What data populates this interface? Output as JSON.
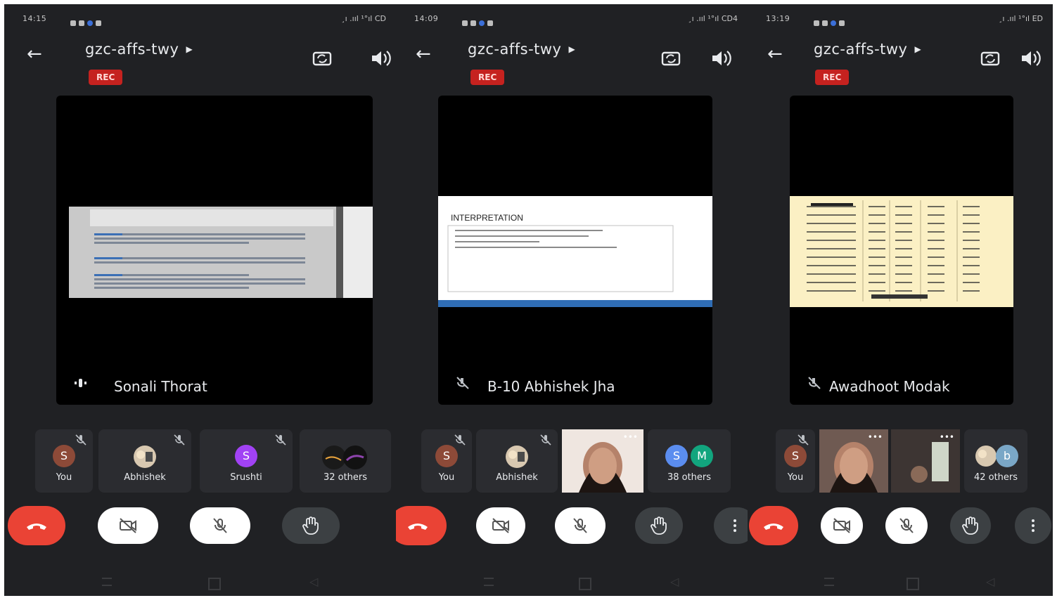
{
  "accent": {
    "red": "#ea4335",
    "rec": "#c5221f",
    "purple": "#8e44ad",
    "teal": "#1e8e3e",
    "blue": "#3c78d8"
  },
  "screens": [
    {
      "time": "14:15",
      "status_right": "¸ı .ııl ¹°ıl CD",
      "meeting_code": "gzc-affs-twy",
      "rec": "REC",
      "presenter": "Sonali Thorat",
      "slide_kind": "doc",
      "slide": {
        "title": "",
        "lines": []
      },
      "participants": [
        {
          "label": "You",
          "initial": "S",
          "type": "avatar-brown",
          "muted": true
        },
        {
          "label": "Abhishek",
          "initial": "",
          "type": "photo",
          "muted": true
        },
        {
          "label": "Srushti",
          "initial": "S",
          "type": "avatar-purple",
          "muted": true
        },
        {
          "label": "32 others",
          "initial": "",
          "type": "group-dark",
          "muted": false
        }
      ]
    },
    {
      "time": "14:09",
      "status_right": "¸ı .ııl ¹°ıl CD4",
      "meeting_code": "gzc-affs-twy",
      "rec": "REC",
      "presenter": "B-10 Abhishek Jha",
      "slide_kind": "text",
      "slide": {
        "title": "INTERPRETATION",
        "lines": []
      },
      "participants": [
        {
          "label": "You",
          "initial": "S",
          "type": "avatar-brown",
          "muted": true
        },
        {
          "label": "Abhishek",
          "initial": "",
          "type": "photo",
          "muted": true
        },
        {
          "label": "",
          "initial": "",
          "type": "video",
          "muted": false
        },
        {
          "label": "38 others",
          "initial": "S",
          "initial2": "M",
          "type": "group-sm",
          "muted": false
        }
      ]
    },
    {
      "time": "13:19",
      "status_right": "¸ı .ııl ¹°ıl ED",
      "meeting_code": "gzc-affs-twy",
      "rec": "REC",
      "presenter": "Awadhoot Modak",
      "slide_kind": "table",
      "slide": {
        "title": "",
        "lines": []
      },
      "participants": [
        {
          "label": "You",
          "initial": "S",
          "type": "avatar-brown",
          "muted": true
        },
        {
          "label": "",
          "initial": "",
          "type": "video",
          "muted": false
        },
        {
          "label": "",
          "initial": "",
          "type": "video2",
          "muted": false
        },
        {
          "label": "42 others",
          "initial": "",
          "initial2": "b",
          "type": "group-pb",
          "muted": false
        }
      ]
    }
  ]
}
